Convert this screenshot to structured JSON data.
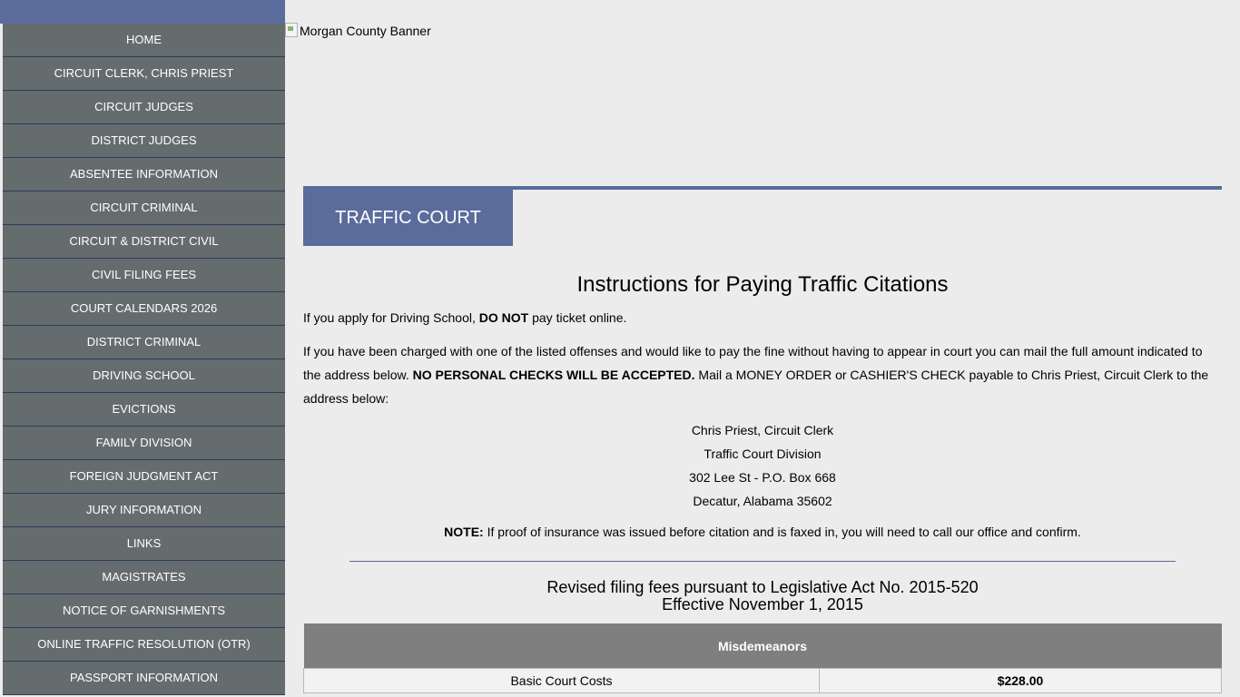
{
  "banner": {
    "alt": "Morgan County Banner"
  },
  "nav": {
    "items": [
      "HOME",
      "CIRCUIT CLERK, CHRIS PRIEST",
      "CIRCUIT JUDGES",
      "DISTRICT JUDGES",
      "ABSENTEE INFORMATION",
      "CIRCUIT CRIMINAL",
      "CIRCUIT & DISTRICT CIVIL",
      "CIVIL FILING FEES",
      "COURT CALENDARS 2026",
      "DISTRICT CRIMINAL",
      "DRIVING SCHOOL",
      "EVICTIONS",
      "FAMILY DIVISION",
      "FOREIGN JUDGMENT ACT",
      "JURY INFORMATION",
      "LINKS",
      "MAGISTRATES",
      "NOTICE OF GARNISHMENTS",
      "ONLINE TRAFFIC RESOLUTION (OTR)",
      "PASSPORT INFORMATION"
    ]
  },
  "section": {
    "title": "TRAFFIC COURT"
  },
  "content": {
    "heading": "Instructions for Paying Traffic Citations",
    "p1_before": "If you apply for Driving School, ",
    "p1_bold": "DO NOT",
    "p1_after": " pay ticket online.",
    "p2_before": "If you have been charged with one of the listed offenses and would like to pay the fine without having to appear in court you can mail the full amount indicated to the address below. ",
    "p2_bold": "NO PERSONAL CHECKS WILL BE ACCEPTED.",
    "p2_after": " Mail a MONEY ORDER or CASHIER'S CHECK payable to Chris Priest, Circuit Clerk to the address below:",
    "address": [
      "Chris Priest, Circuit Clerk",
      "Traffic Court Division",
      "302 Lee St - P.O. Box 668",
      "Decatur, Alabama 35602"
    ],
    "note_label": "NOTE:",
    "note_text": " If proof of insurance was issued before citation and is faxed in, you will need to call our office and confirm.",
    "fees_title_line1": "Revised filing fees pursuant to Legislative Act No. 2015-520",
    "fees_title_line2": "Effective November 1, 2015"
  },
  "fees_table": {
    "header": "Misdemeanors",
    "rows": [
      {
        "label": "Basic Court Costs",
        "amount": "$228.00"
      }
    ]
  },
  "colors": {
    "accent": "#5a6b9c",
    "nav_bg": "#656c6e",
    "nav_border": "#2a3d5c",
    "table_header": "#7f7f7f"
  }
}
